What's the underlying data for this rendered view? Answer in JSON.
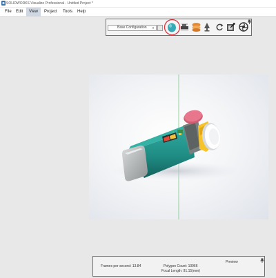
{
  "window": {
    "title": "SOLIDWORKS Visualize Professional - Untitled Project *"
  },
  "menu": {
    "items": [
      "File",
      "Edit",
      "View",
      "Project",
      "Tools",
      "Help"
    ],
    "active": "View"
  },
  "toolbar": {
    "configuration_value": "Base Configuration",
    "tools": [
      "preview-render-icon",
      "camera-render-icon",
      "stack-icon",
      "lamp-icon",
      "refresh-icon",
      "export-icon",
      "aperture-icon"
    ],
    "highlight_color": "#e0323c"
  },
  "preview": {
    "label": "Preview",
    "fps_label": "Frames per second: 13.84",
    "polygon_label": "Polygon Count: 10966",
    "focal_label": "Focal Length: 91.15(mm)"
  },
  "colors": {
    "housing": "#1f8c84",
    "end_cap": "#b9bcbc",
    "lens_ring": "#f6c32a",
    "lens": "#ffffff",
    "top_button": "#e8768c",
    "ui_teal": "#35a9b5"
  }
}
